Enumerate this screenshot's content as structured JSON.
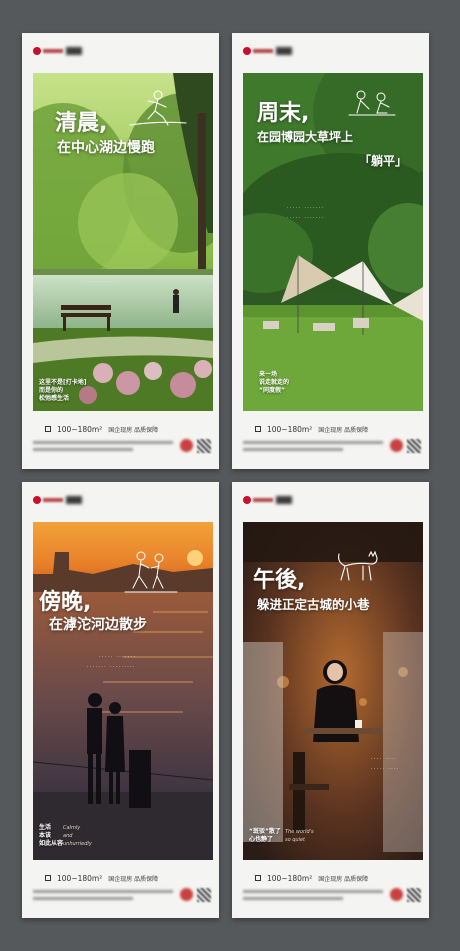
{
  "posters": [
    {
      "heading": "清晨,",
      "subheading": "在中心湖边慢跑",
      "caption_lines": [
        "这里不是[打卡地]",
        "而是你的",
        "松弛感生活"
      ],
      "footer_area": "100~180m²",
      "footer_tags": "国企现房  品质保障",
      "sketch_icon": "jogger-sketch-icon"
    },
    {
      "heading": "周末,",
      "subheading": "在园博园大草坪上",
      "highlight": "「躺平」",
      "caption_lines": [
        "来一场",
        "说走就走的",
        "“同度假”"
      ],
      "footer_area": "100~180m²",
      "footer_tags": "国企现房  品质保障",
      "sketch_icon": "lounging-people-sketch-icon"
    },
    {
      "heading": "傍晚,",
      "subheading": "在滹沱河边散步",
      "caption_lines": [
        "生活",
        "本该",
        "如此从容"
      ],
      "caption_script": [
        "Calmly",
        "and",
        "unhurriedly"
      ],
      "footer_area": "100~180m²",
      "footer_tags": "国企现房  品质保障",
      "sketch_icon": "walking-couple-sketch-icon"
    },
    {
      "heading": "午後,",
      "subheading": "躲进正定古城的小巷",
      "caption_lines": [
        "“斑驳”散了",
        "心也静了"
      ],
      "caption_script": [
        "The world's",
        "so quiet"
      ],
      "footer_area": "100~180m²",
      "footer_tags": "国企现房  品质保障",
      "sketch_icon": "cat-sketch-icon"
    }
  ],
  "colors": {
    "background": "#55595c",
    "card": "#f4f4f2",
    "brand_red": "#c8102e"
  }
}
